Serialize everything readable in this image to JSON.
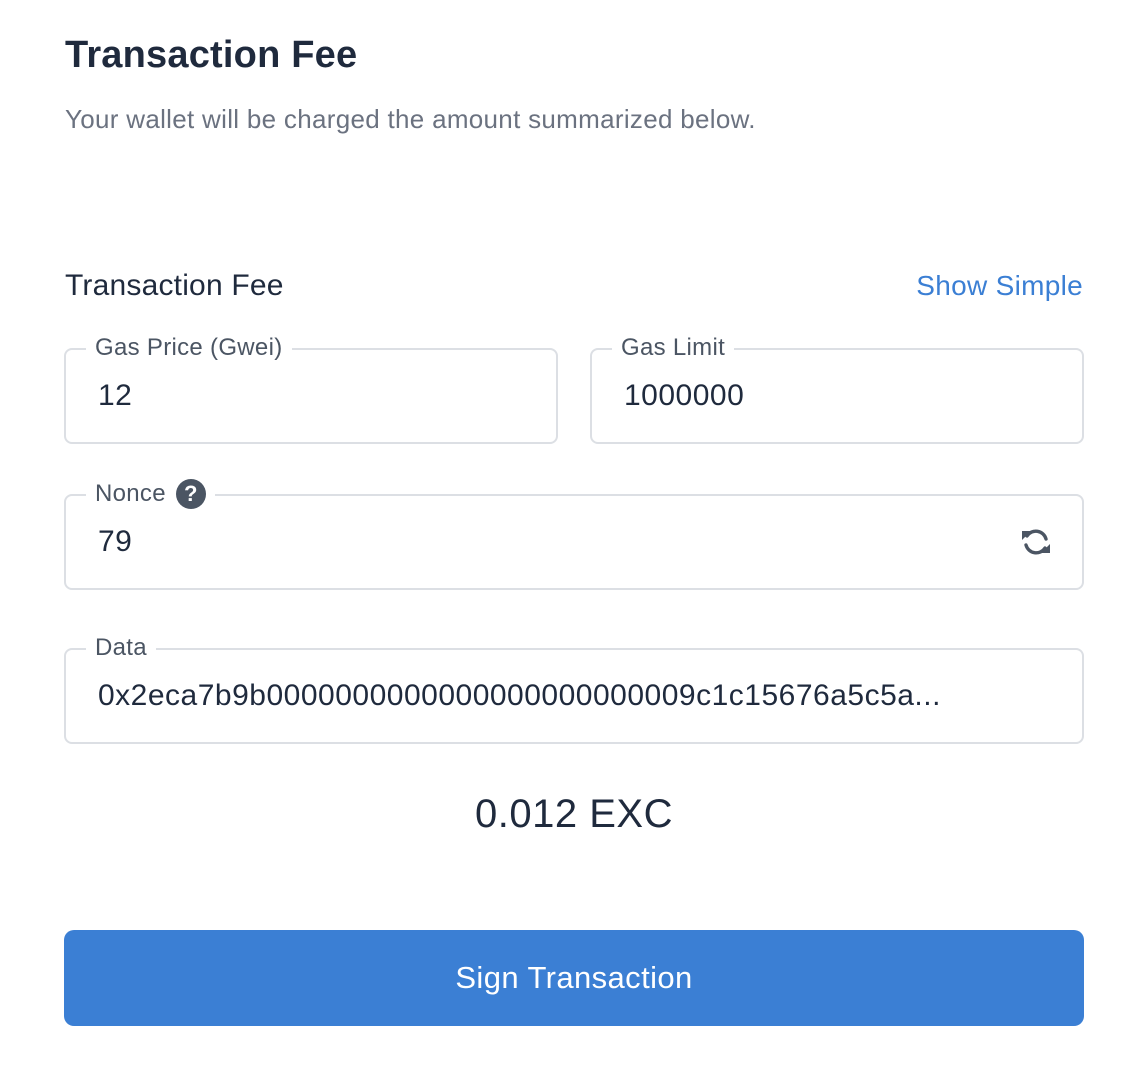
{
  "header": {
    "title": "Transaction Fee",
    "subtitle": "Your wallet will be charged the amount summarized below."
  },
  "fee_section": {
    "title": "Transaction Fee",
    "toggle_label": "Show Simple"
  },
  "fields": {
    "gas_price": {
      "label": "Gas Price (Gwei)",
      "value": "12"
    },
    "gas_limit": {
      "label": "Gas Limit",
      "value": "1000000"
    },
    "nonce": {
      "label": "Nonce",
      "value": "79",
      "help_glyph": "?"
    },
    "data": {
      "label": "Data",
      "value": "0x2eca7b9b0000000000000000000000009c1c15676a5c5a..."
    }
  },
  "total": "0.012 EXC",
  "actions": {
    "sign_label": "Sign Transaction"
  },
  "colors": {
    "accent": "#3b7fd4",
    "text": "#1f2a3d",
    "muted": "#6b7280",
    "border": "#dcdfe4"
  },
  "icons": {
    "help": "question-circle-icon",
    "refresh": "refresh-icon"
  }
}
